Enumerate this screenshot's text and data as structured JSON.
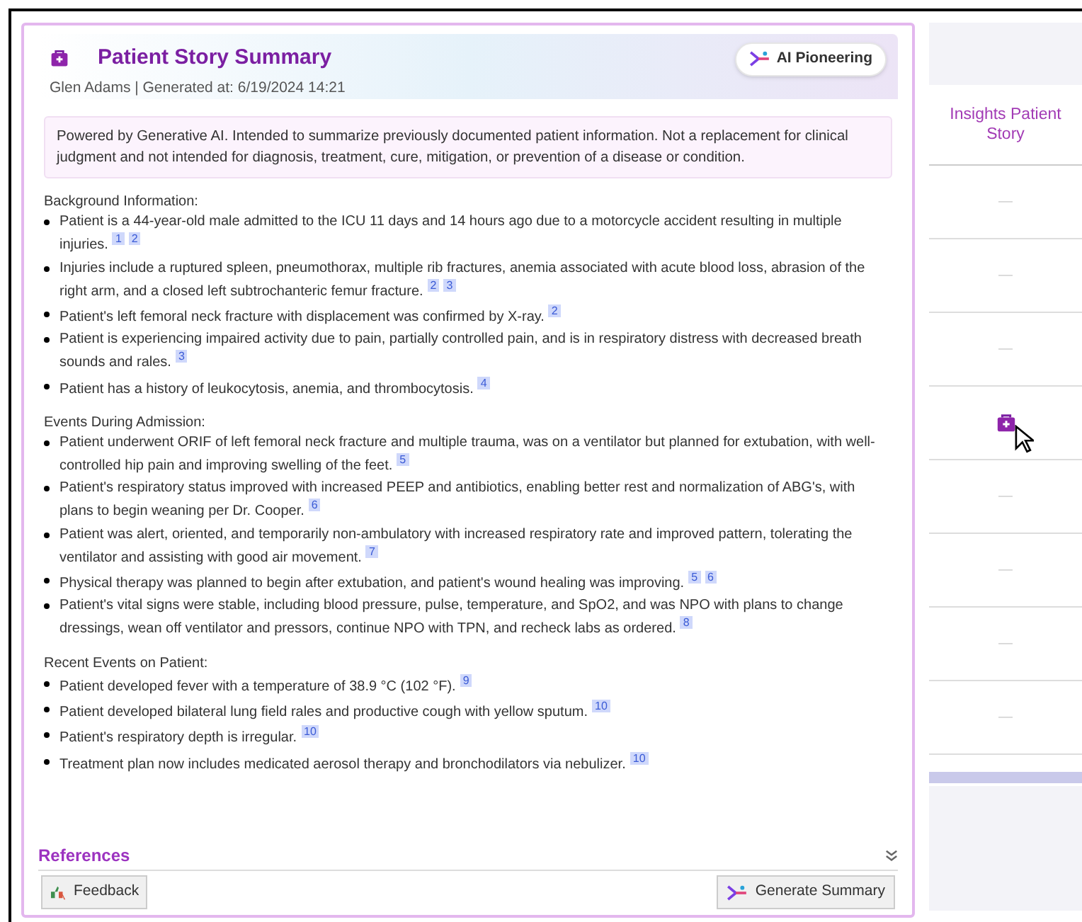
{
  "card": {
    "title": "Patient Story Summary",
    "badge": "AI Pioneering",
    "subtitle": "Glen Adams | Generated at: 6/19/2024 14:21",
    "disclaimer": "Powered by Generative AI. Intended to summarize previously documented patient information. Not a replacement for clinical judgment and not intended for diagnosis, treatment, cure, mitigation, or prevention of a disease or condition.",
    "sections": [
      {
        "heading": "Background Information:",
        "items": [
          {
            "text": "Patient is a 44-year-old male admitted to the ICU 11 days and 14 hours ago due to a motorcycle accident resulting in multiple injuries.",
            "refs": [
              "1",
              "2"
            ]
          },
          {
            "text": "Injuries include a ruptured spleen, pneumothorax, multiple rib fractures, anemia associated with acute blood loss, abrasion of the right arm, and a closed left subtrochanteric femur fracture.",
            "refs": [
              "2",
              "3"
            ]
          },
          {
            "text": "Patient's left femoral neck fracture with displacement was confirmed by X-ray.",
            "refs": [
              "2"
            ]
          },
          {
            "text": "Patient is experiencing impaired activity due to pain, partially controlled pain, and is in respiratory distress with decreased breath sounds and rales.",
            "refs": [
              "3"
            ]
          },
          {
            "text": "Patient has a history of leukocytosis, anemia, and thrombocytosis.",
            "refs": [
              "4"
            ]
          }
        ]
      },
      {
        "heading": "Events During Admission:",
        "items": [
          {
            "text": "Patient underwent ORIF of left femoral neck fracture and multiple trauma, was on a ventilator but planned for extubation, with well-controlled hip pain and improving swelling of the feet.",
            "refs": [
              "5"
            ]
          },
          {
            "text": "Patient's respiratory status improved with increased PEEP and antibiotics, enabling better rest and normalization of ABG's, with plans to begin weaning per Dr. Cooper.",
            "refs": [
              "6"
            ]
          },
          {
            "text": "Patient was alert, oriented, and temporarily non-ambulatory with increased respiratory rate and improved pattern, tolerating the ventilator and assisting with good air movement.",
            "refs": [
              "7"
            ]
          },
          {
            "text": "Physical therapy was planned to begin after extubation, and patient's wound healing was improving.",
            "refs": [
              "5",
              "6"
            ]
          },
          {
            "text": "Patient's vital signs were stable, including blood pressure, pulse, temperature, and SpO2, and was NPO with plans to change dressings, wean off ventilator and pressors, continue NPO with TPN, and recheck labs as ordered.",
            "refs": [
              "8"
            ]
          }
        ]
      },
      {
        "heading": "Recent Events on Patient:",
        "items": [
          {
            "text": "Patient developed fever with a temperature of 38.9 °C (102 °F).",
            "refs": [
              "9"
            ]
          },
          {
            "text": "Patient developed bilateral lung field rales and productive cough with yellow sputum.",
            "refs": [
              "10"
            ]
          },
          {
            "text": "Patient's respiratory depth is irregular.",
            "refs": [
              "10"
            ]
          },
          {
            "text": "Treatment plan now includes medicated aerosol therapy and bronchodilators via nebulizer.",
            "refs": [
              "10"
            ]
          }
        ]
      }
    ],
    "references": {
      "label": "References",
      "expanded": false
    },
    "buttons": [
      "Feedback",
      "Generate Summary"
    ]
  },
  "table": {
    "column": "Insights Patient Story",
    "rows": [
      {
        "kind": "empty",
        "text": "—"
      },
      {
        "kind": "empty",
        "text": "—"
      },
      {
        "kind": "empty",
        "text": "—"
      },
      {
        "kind": "icon"
      },
      {
        "kind": "empty",
        "text": "—"
      },
      {
        "kind": "empty",
        "text": "—"
      },
      {
        "kind": "empty",
        "text": "—"
      },
      {
        "kind": "empty",
        "text": "—"
      }
    ]
  }
}
